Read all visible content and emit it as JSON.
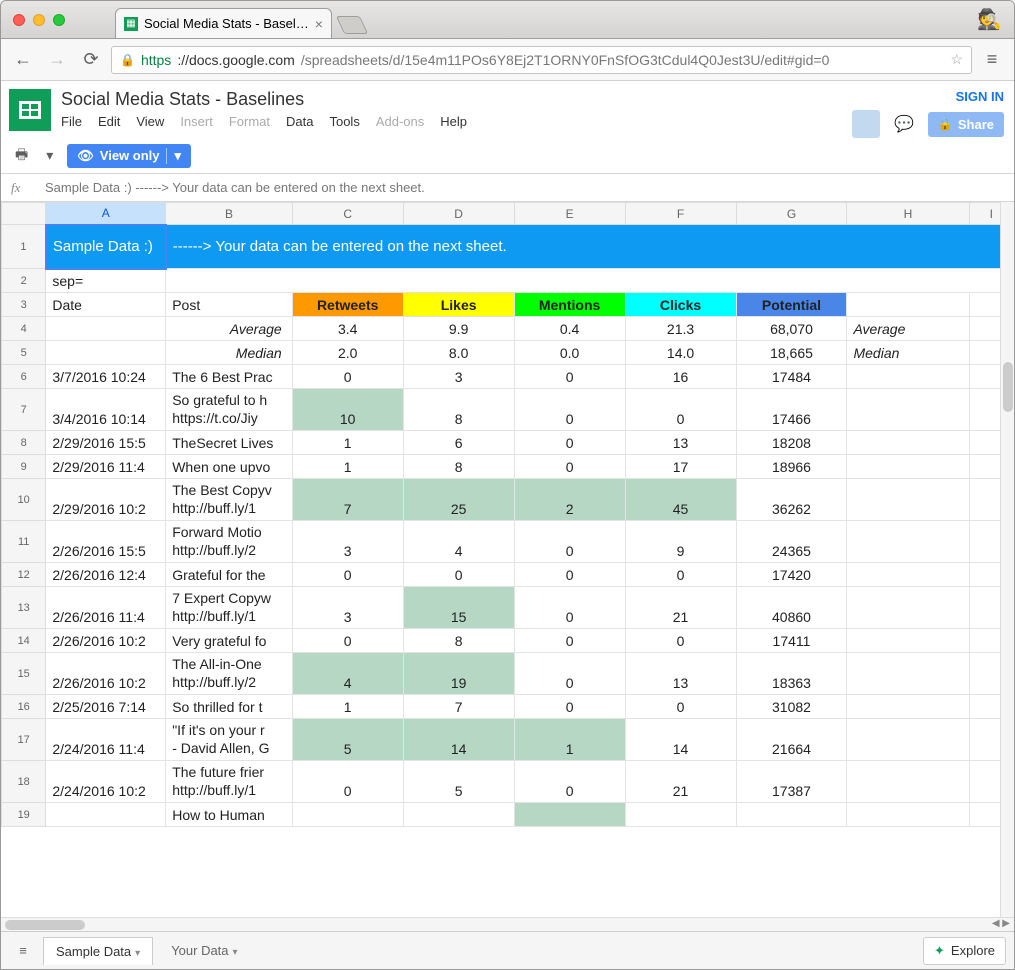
{
  "browser": {
    "tab_title": "Social Media Stats - Basel…",
    "url_https": "https",
    "url_host": "://docs.google.com",
    "url_path": "/spreadsheets/d/15e4m11POs6Y8Ej2T1ORNY0FnSfOG3tCdul4Q0Jest3U/edit#gid=0"
  },
  "docs": {
    "title": "Social Media Stats - Baselines",
    "menus": {
      "file": "File",
      "edit": "Edit",
      "view": "View",
      "insert": "Insert",
      "format": "Format",
      "data": "Data",
      "tools": "Tools",
      "addons": "Add-ons",
      "help": "Help"
    },
    "signin": "SIGN IN",
    "share": "Share",
    "viewonly": "View only"
  },
  "formula": "Sample Data :)   ------> Your data can be entered on the next sheet.",
  "columns": [
    "A",
    "B",
    "C",
    "D",
    "E",
    "F",
    "G",
    "H",
    "I"
  ],
  "row1": {
    "a": "Sample Data :)",
    "rest": "------> Your data can be entered on the next sheet."
  },
  "row2": {
    "a": "sep="
  },
  "headers": {
    "date": "Date",
    "post": "Post",
    "retweets": "Retweets",
    "likes": "Likes",
    "mentions": "Mentions",
    "clicks": "Clicks",
    "potential": "Potential"
  },
  "stats": {
    "avg": {
      "label": "Average",
      "retweets": "3.4",
      "likes": "9.9",
      "mentions": "0.4",
      "clicks": "21.3",
      "potential": "68,070",
      "rlabel": "Average"
    },
    "med": {
      "label": "Median",
      "retweets": "2.0",
      "likes": "8.0",
      "mentions": "0.0",
      "clicks": "14.0",
      "potential": "18,665",
      "rlabel": "Median"
    }
  },
  "rows": [
    {
      "n": 6,
      "tall": false,
      "date": "3/7/2016 10:24",
      "post": "The 6 Best Prac",
      "rt": "0",
      "lk": "3",
      "mn": "0",
      "ck": "16",
      "pt": "17484",
      "hl": []
    },
    {
      "n": 7,
      "tall": true,
      "date": "3/4/2016 10:14",
      "post": "So grateful to h\nhttps://t.co/Jiy",
      "rt": "10",
      "lk": "8",
      "mn": "0",
      "ck": "0",
      "pt": "17466",
      "hl": [
        "rt"
      ]
    },
    {
      "n": 8,
      "tall": false,
      "date": "2/29/2016 15:5",
      "post": "TheSecret Lives",
      "rt": "1",
      "lk": "6",
      "mn": "0",
      "ck": "13",
      "pt": "18208",
      "hl": []
    },
    {
      "n": 9,
      "tall": false,
      "date": "2/29/2016 11:4",
      "post": "When one upvo",
      "rt": "1",
      "lk": "8",
      "mn": "0",
      "ck": "17",
      "pt": "18966",
      "hl": []
    },
    {
      "n": 10,
      "tall": true,
      "date": "2/29/2016 10:2",
      "post": "The Best Copyv\nhttp://buff.ly/1",
      "rt": "7",
      "lk": "25",
      "mn": "2",
      "ck": "45",
      "pt": "36262",
      "hl": [
        "rt",
        "lk",
        "mn",
        "ck"
      ]
    },
    {
      "n": 11,
      "tall": true,
      "date": "2/26/2016 15:5",
      "post": "Forward Motio\nhttp://buff.ly/2",
      "rt": "3",
      "lk": "4",
      "mn": "0",
      "ck": "9",
      "pt": "24365",
      "hl": []
    },
    {
      "n": 12,
      "tall": false,
      "date": "2/26/2016 12:4",
      "post": "Grateful for the",
      "rt": "0",
      "lk": "0",
      "mn": "0",
      "ck": "0",
      "pt": "17420",
      "hl": []
    },
    {
      "n": 13,
      "tall": true,
      "date": "2/26/2016 11:4",
      "post": "7 Expert Copyw\nhttp://buff.ly/1",
      "rt": "3",
      "lk": "15",
      "mn": "0",
      "ck": "21",
      "pt": "40860",
      "hl": [
        "lk"
      ]
    },
    {
      "n": 14,
      "tall": false,
      "date": "2/26/2016 10:2",
      "post": "Very grateful fo",
      "rt": "0",
      "lk": "8",
      "mn": "0",
      "ck": "0",
      "pt": "17411",
      "hl": []
    },
    {
      "n": 15,
      "tall": true,
      "date": "2/26/2016 10:2",
      "post": "The All-in-One\nhttp://buff.ly/2",
      "rt": "4",
      "lk": "19",
      "mn": "0",
      "ck": "13",
      "pt": "18363",
      "hl": [
        "rt",
        "lk"
      ]
    },
    {
      "n": 16,
      "tall": false,
      "date": "2/25/2016 7:14",
      "post": "So thrilled for t",
      "rt": "1",
      "lk": "7",
      "mn": "0",
      "ck": "0",
      "pt": "31082",
      "hl": []
    },
    {
      "n": 17,
      "tall": true,
      "date": "2/24/2016 11:4",
      "post": "\"If it's on your r\n- David Allen, G",
      "rt": "5",
      "lk": "14",
      "mn": "1",
      "ck": "14",
      "pt": "21664",
      "hl": [
        "rt",
        "lk",
        "mn"
      ]
    },
    {
      "n": 18,
      "tall": true,
      "date": "2/24/2016 10:2",
      "post": "The future frier\nhttp://buff.ly/1",
      "rt": "0",
      "lk": "5",
      "mn": "0",
      "ck": "21",
      "pt": "17387",
      "hl": []
    },
    {
      "n": 19,
      "tall": false,
      "date": "",
      "post": "How to Human",
      "rt": "",
      "lk": "",
      "mn": "",
      "ck": "",
      "pt": "",
      "hl": [
        "mn"
      ]
    }
  ],
  "tabs": {
    "active": "Sample Data",
    "other": "Your Data"
  },
  "explore": "Explore"
}
